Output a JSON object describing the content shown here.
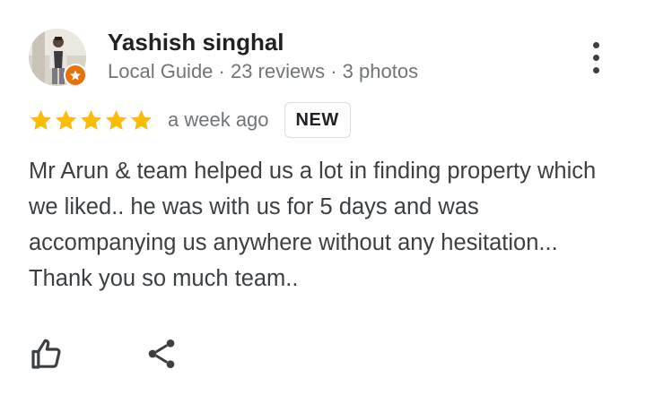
{
  "reviewer": {
    "name": "Yashish singhal",
    "meta": "Local Guide · 23 reviews · 3 photos",
    "avatar_icon": "person-photo",
    "badge_icon": "local-guide-star-icon",
    "badge_color": "#e8710a"
  },
  "menu": {
    "icon": "more-vert-icon"
  },
  "rating": {
    "stars": 5,
    "max_stars": 5,
    "star_color": "#fbbc04",
    "time": "a week ago",
    "badge": "NEW"
  },
  "review": {
    "text": "Mr Arun & team helped us a lot in finding property which we liked.. he was with us for 5 days and was accompanying us anywhere without any hesitation... Thank you so much team.."
  },
  "actions": {
    "like_icon": "thumb-up-icon",
    "share_icon": "share-icon"
  }
}
